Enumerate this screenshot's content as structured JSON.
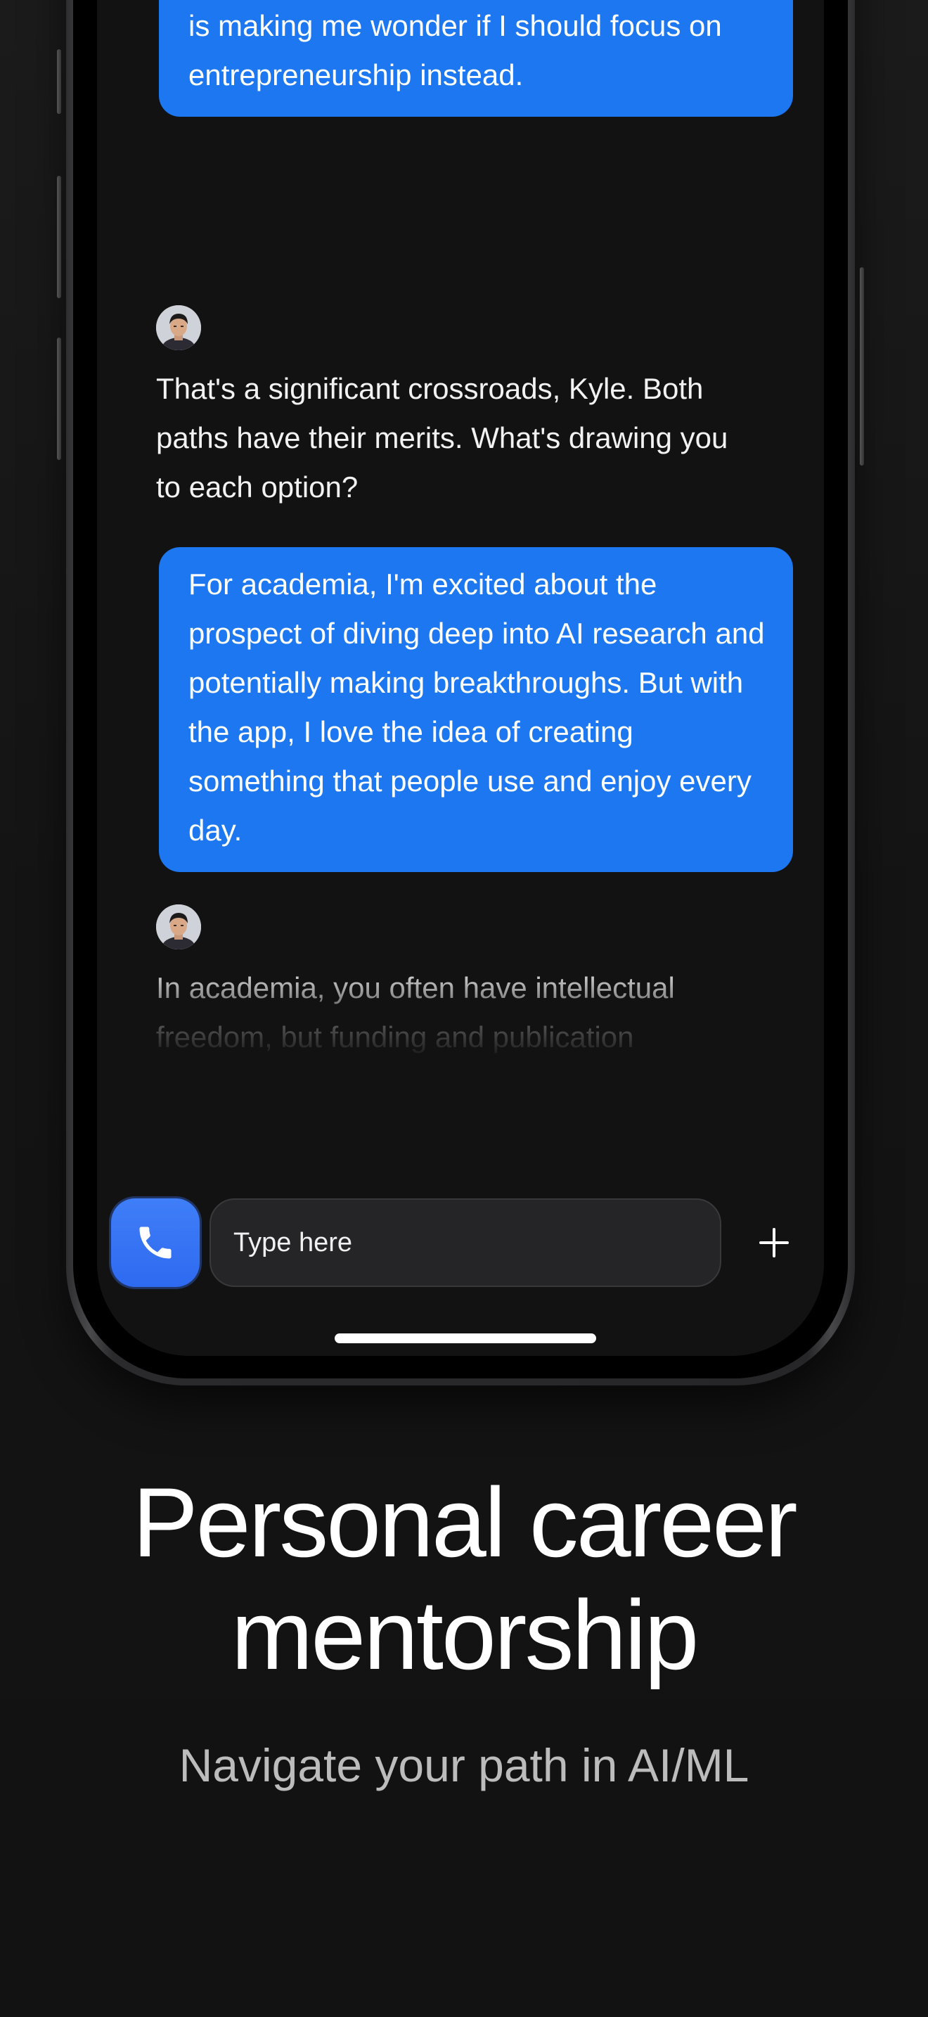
{
  "chat": {
    "messages": [
      {
        "role": "user",
        "text": "I'm trying to decide between pursuing a career in academia or going all-in on my app. I love research, but the app's success is making me wonder if I should focus on entrepreneurship instead."
      },
      {
        "role": "assistant",
        "text": "That's a significant crossroads, Kyle. Both paths have their merits. What's drawing you to each option?"
      },
      {
        "role": "user",
        "text": "For academia, I'm excited about the prospect of diving deep into AI research and potentially making breakthroughs. But with the app, I love the idea of creating something that people use and enjoy every day."
      },
      {
        "role": "assistant",
        "text": "In academia, you often have intellectual freedom, but funding and publication pressures are real. With a startup, you"
      }
    ]
  },
  "input": {
    "placeholder": "Type here",
    "call_icon": "phone-icon",
    "add_icon": "plus-icon"
  },
  "headline": {
    "title": "Personal career mentorship",
    "subtitle": "Navigate your path in AI/ML"
  },
  "colors": {
    "accent": "#1c77f0",
    "call_button": "#3a78f6",
    "background": "#121212",
    "input_background": "#252527"
  }
}
